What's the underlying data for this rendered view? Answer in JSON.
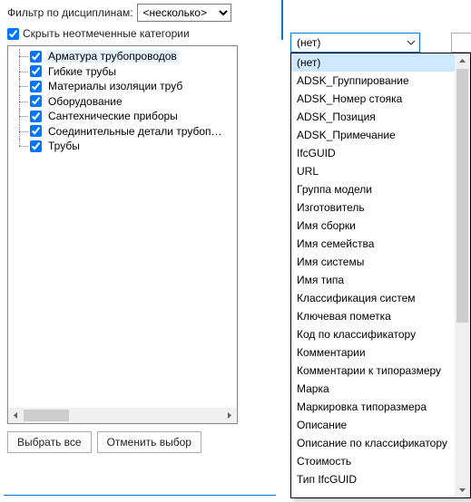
{
  "filter": {
    "label": "Фильтр по дисциплинам:",
    "value": "<несколько>"
  },
  "hide_unchecked": {
    "label": "Скрыть неотмеченные категории",
    "checked": true
  },
  "categories": [
    {
      "label": "Арматура трубопроводов",
      "checked": true,
      "selected": true
    },
    {
      "label": "Гибкие трубы",
      "checked": true,
      "selected": false
    },
    {
      "label": "Материалы изоляции труб",
      "checked": true,
      "selected": false
    },
    {
      "label": "Оборудование",
      "checked": true,
      "selected": false
    },
    {
      "label": "Сантехнические приборы",
      "checked": true,
      "selected": false
    },
    {
      "label": "Соединительные детали трубопрово...",
      "checked": true,
      "selected": false
    },
    {
      "label": "Трубы",
      "checked": true,
      "selected": false
    }
  ],
  "buttons": {
    "select_all": "Выбрать все",
    "deselect": "Отменить выбор"
  },
  "dropdown": {
    "selected": "(нет)",
    "items": [
      "(нет)",
      "ADSK_Группирование",
      "ADSK_Номер стояка",
      "ADSK_Позиция",
      "ADSK_Примечание",
      "IfcGUID",
      "URL",
      "Группа модели",
      "Изготовитель",
      "Имя сборки",
      "Имя семейства",
      "Имя системы",
      "Имя типа",
      "Классификация систем",
      "Ключевая пометка",
      "Код по классификатору",
      "Комментарии",
      "Комментарии к типоразмеру",
      "Марка",
      "Маркировка типоразмера",
      "Описание",
      "Описание по классификатору",
      "Стоимость",
      "Тип IfcGUID"
    ],
    "selected_index": 0
  }
}
